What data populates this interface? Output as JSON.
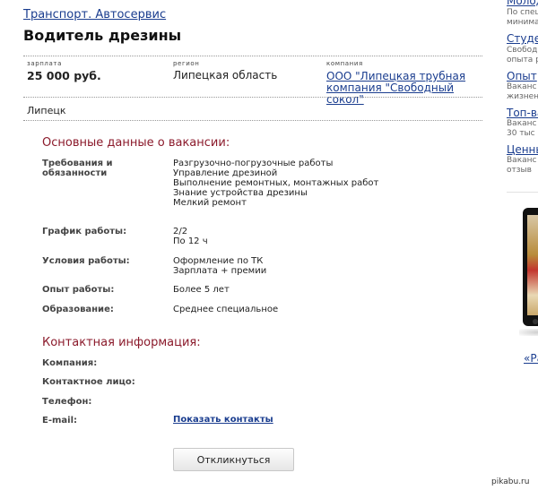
{
  "breadcrumb": "Транспорт. Автосервис",
  "title": "Водитель дрезины",
  "meta": {
    "salary_label": "зарплата",
    "salary_value": "25 000 руб.",
    "region_label": "регион",
    "region_value": "Липецкая область",
    "company_label": "компания",
    "company_value": "ООО \"Липецкая трубная компания \"Свободный сокол\""
  },
  "city": "Липецк",
  "main_section": {
    "heading": "Основные данные о вакансии:",
    "duties_label": "Требования и обязанности",
    "duties": [
      "Разгрузочно-погрузочные работы",
      "Управление дрезиной",
      "Выполнение ремонтных, монтажных работ",
      "Знание устройства дрезины",
      "Мелкий ремонт"
    ],
    "schedule_label": "График работы:",
    "schedule": [
      "2/2",
      "По 12 ч"
    ],
    "conditions_label": "Условия работы:",
    "conditions": [
      "Оформление по ТК",
      "Зарплата + премии"
    ],
    "experience_label": "Опыт работы:",
    "experience_value": "Более 5 лет",
    "education_label": "Образование:",
    "education_value": "Среднее специальное"
  },
  "contact_section": {
    "heading": "Контактная информация:",
    "company_label": "Компания:",
    "person_label": "Контактное лицо:",
    "phone_label": "Телефон:",
    "email_label": "E-mail:",
    "show_contacts": "Показать контакты"
  },
  "respond_button": "Откликнуться",
  "sidebar": {
    "items": [
      {
        "title": "Молод",
        "lines": [
          "По спец",
          "минима"
        ]
      },
      {
        "title": "Студе",
        "lines": [
          "Свобод",
          "опыта р"
        ]
      },
      {
        "title": "Опыт",
        "lines": [
          "Ваканс",
          "жизнен"
        ]
      },
      {
        "title": "Топ-ва",
        "lines": [
          "Ваканс",
          "30 тыс"
        ]
      },
      {
        "title": "Ценны",
        "lines": [
          "Ваканс",
          "отзыв"
        ]
      }
    ],
    "more_link": "«Ра"
  },
  "watermark": "pikabu.ru"
}
